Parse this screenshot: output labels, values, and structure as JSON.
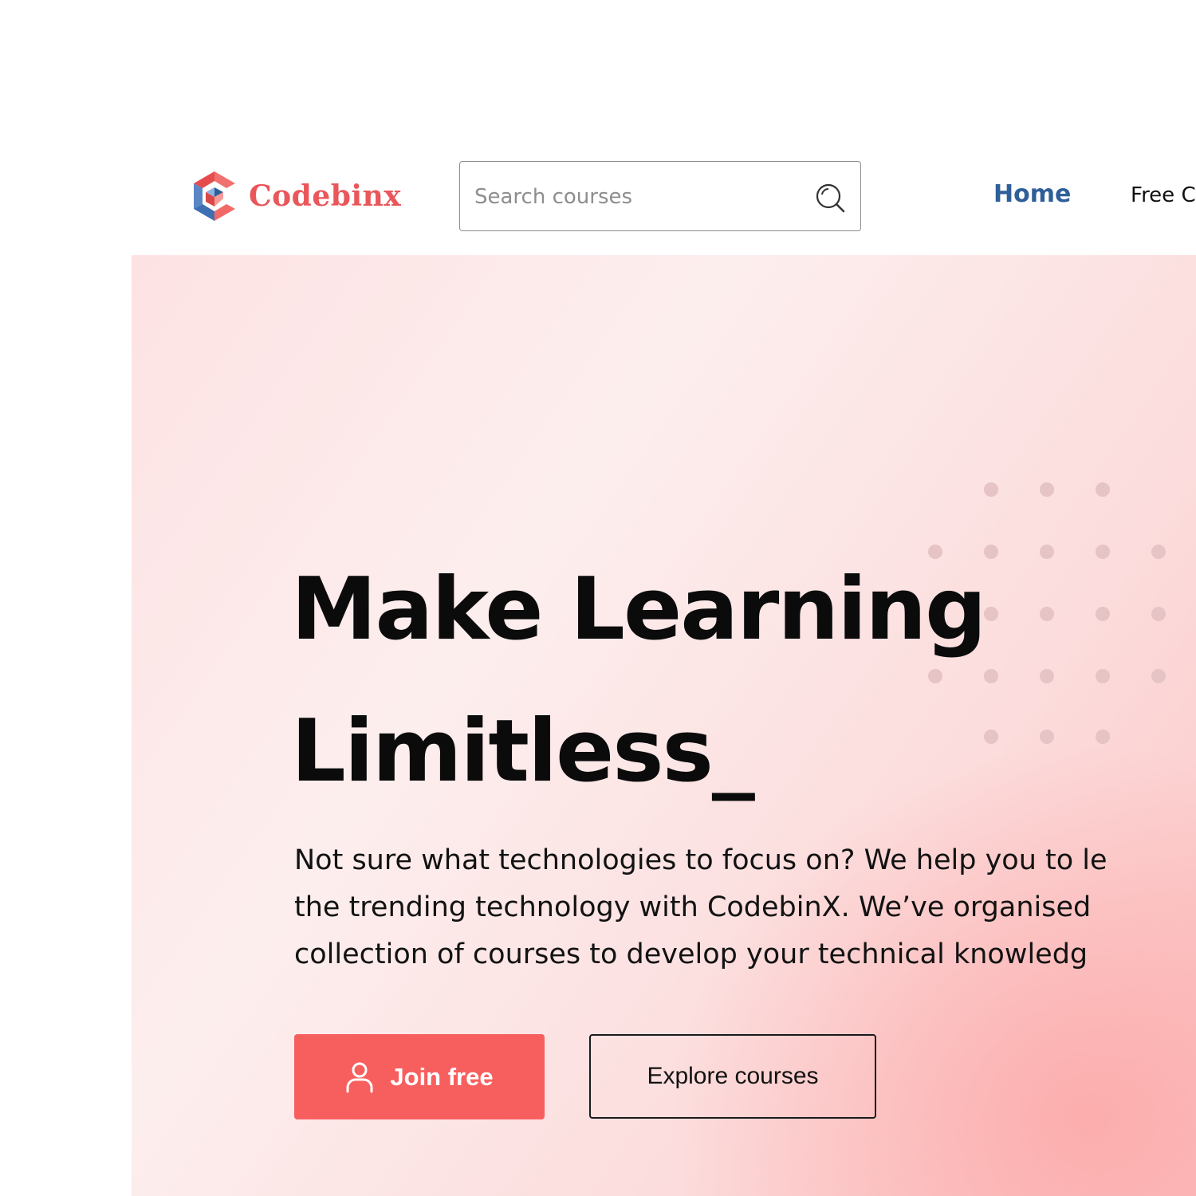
{
  "header": {
    "logo_text": "Codebinx",
    "search": {
      "placeholder": "Search courses",
      "icon": "search-icon"
    },
    "nav": {
      "home_label": "Home",
      "free_label": "Free C"
    }
  },
  "hero": {
    "title_line1": "Make Learning",
    "title_line2": "Limitless_",
    "description": [
      "Not sure what technologies to focus on? We help you to le",
      "the trending technology with CodebinX. We’ve organised",
      "collection of courses to develop your technical knowledg"
    ],
    "join_button_label": "Join free",
    "join_button_icon": "user-icon",
    "explore_button_label": "Explore courses"
  },
  "colors": {
    "brand": "#e9575b",
    "nav_active": "#2f5f99",
    "primary_button": "#f75f5f",
    "hero_background": "#fde6e6"
  }
}
